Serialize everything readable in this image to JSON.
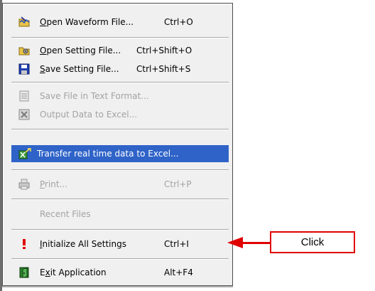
{
  "menu": {
    "items": [
      {
        "id": "open-waveform",
        "label": "Open Waveform File...",
        "accel": "Ctrl+O",
        "icon": "open-waveform-icon",
        "mnemonic": "O",
        "state": "normal"
      },
      {
        "id": "open-setting",
        "label": "Open Setting File...",
        "accel": "Ctrl+Shift+O",
        "icon": "open-setting-icon",
        "mnemonic": "O",
        "state": "normal"
      },
      {
        "id": "save-setting",
        "label": "Save Setting File...",
        "accel": "Ctrl+Shift+S",
        "icon": "save-disk-icon",
        "mnemonic": "S",
        "state": "normal"
      },
      {
        "id": "save-text",
        "label": "Save File in Text Format...",
        "accel": "",
        "icon": "text-file-icon",
        "mnemonic": "",
        "state": "disabled"
      },
      {
        "id": "output-excel",
        "label": "Output Data to Excel...",
        "accel": "",
        "icon": "excel-output-icon",
        "mnemonic": "",
        "state": "disabled"
      },
      {
        "id": "transfer-realtime",
        "label": "Transfer real time data to Excel...",
        "accel": "",
        "icon": "excel-transfer-icon",
        "mnemonic": "",
        "state": "highlighted"
      },
      {
        "id": "print",
        "label": "Print...",
        "accel": "Ctrl+P",
        "icon": "printer-icon",
        "mnemonic": "P",
        "state": "disabled"
      },
      {
        "id": "recent-files",
        "label": "Recent Files",
        "accel": "",
        "icon": "",
        "mnemonic": "",
        "state": "disabled"
      },
      {
        "id": "initialize",
        "label": "Initialize All Settings",
        "accel": "Ctrl+I",
        "icon": "exclamation-icon",
        "mnemonic": "I",
        "state": "normal"
      },
      {
        "id": "exit",
        "label": "Exit Application",
        "accel": "Alt+F4",
        "icon": "exit-door-icon",
        "mnemonic": "x",
        "state": "normal"
      }
    ]
  },
  "callout": {
    "label": "Click",
    "color": "#e00000"
  },
  "colors": {
    "highlight": "#2f63c8",
    "disabled": "#a3a3a3",
    "menu_bg": "#f0f0f0"
  }
}
